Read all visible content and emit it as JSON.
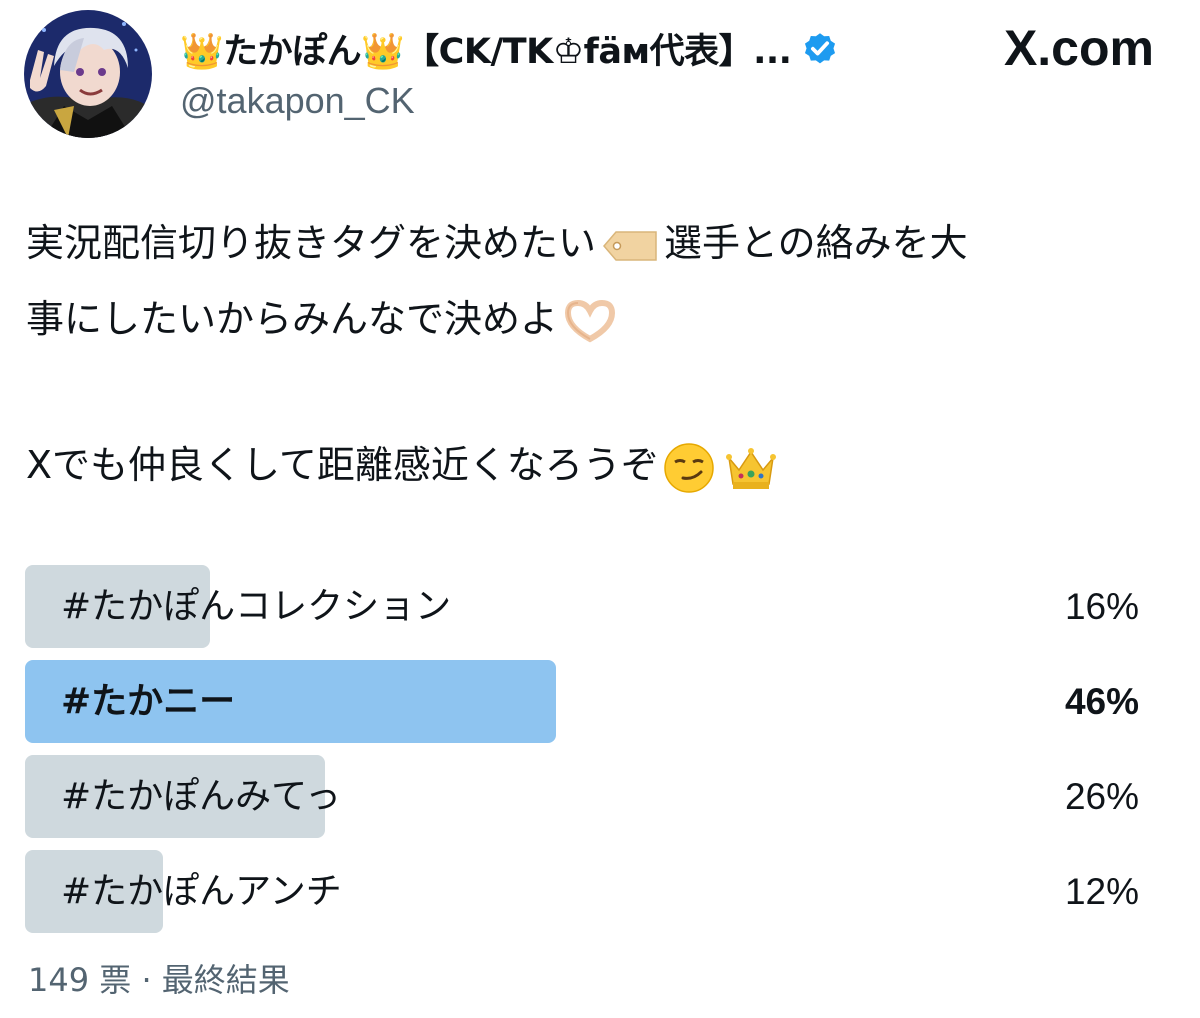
{
  "author": {
    "display_name": "👑たかぽん👑【CK/TK♔fäм代表】...",
    "handle": "@takapon_CK",
    "verified": true,
    "avatar_icon": "avatar-illustration"
  },
  "brand": {
    "label": "X.com",
    "icon": "x-logo-icon"
  },
  "tweet": {
    "line1a": "実況配信切り抜きタグを決めたい",
    "line1b": "選手との絡みを大",
    "line2": "事にしたいからみんなで決めよ",
    "line3": "Xでも仲良くして距離感近くなろうぞ"
  },
  "poll": {
    "options": [
      {
        "label": "#たかぽんコレクション",
        "percent": "16%",
        "value": 16
      },
      {
        "label": "#たかニー",
        "percent": "46%",
        "value": 46,
        "winner": true
      },
      {
        "label": "#たかぽんみてっ",
        "percent": "26%",
        "value": 26
      },
      {
        "label": "#たかぽんアンチ",
        "percent": "12%",
        "value": 12
      }
    ],
    "votes": "149 票",
    "separator": " · ",
    "status": "最終結果"
  },
  "colors": {
    "bar_default": "#cfd9de",
    "bar_winner": "#8ec4f0",
    "verified_blue": "#1d9bf0",
    "secondary_text": "#536471"
  }
}
